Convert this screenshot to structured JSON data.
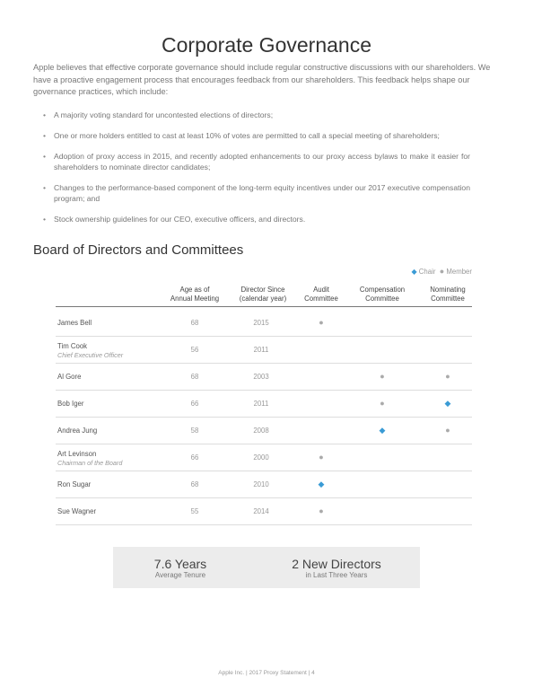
{
  "page": {
    "title": "Corporate Governance",
    "intro": "Apple believes that effective corporate governance should include regular constructive discussions with our shareholders. We have a proactive engagement process that encourages feedback from our shareholders. This feedback helps shape our governance practices, which include:",
    "bullets": [
      "A majority voting standard for uncontested elections of directors;",
      "One or more holders entitled to cast at least 10% of votes are permitted to call a special meeting of shareholders;",
      "Adoption of proxy access in 2015, and recently adopted enhancements to our proxy access bylaws to make it easier for shareholders to nominate director candidates;",
      "Changes to the performance-based component of the long-term equity incentives under our 2017 executive compensation program; and",
      "Stock ownership guidelines for our CEO, executive officers, and directors."
    ]
  },
  "board": {
    "heading": "Board of Directors and Committees",
    "legend": {
      "chair": "Chair",
      "member": "Member"
    },
    "columns": {
      "age_line1": "Age as of",
      "age_line2": "Annual Meeting",
      "since_line1": "Director Since",
      "since_line2": "(calendar year)",
      "audit_line1": "Audit",
      "audit_line2": "Committee",
      "comp_line1": "Compensation",
      "comp_line2": "Committee",
      "nom_line1": "Nominating",
      "nom_line2": "Committee"
    },
    "rows": [
      {
        "name": "James Bell",
        "role": "",
        "age": "68",
        "since": "2015",
        "audit": "member",
        "comp": "",
        "nom": ""
      },
      {
        "name": "Tim Cook",
        "role": "Chief Executive Officer",
        "age": "56",
        "since": "2011",
        "audit": "",
        "comp": "",
        "nom": ""
      },
      {
        "name": "Al Gore",
        "role": "",
        "age": "68",
        "since": "2003",
        "audit": "",
        "comp": "member",
        "nom": "member"
      },
      {
        "name": "Bob Iger",
        "role": "",
        "age": "66",
        "since": "2011",
        "audit": "",
        "comp": "member",
        "nom": "chair"
      },
      {
        "name": "Andrea Jung",
        "role": "",
        "age": "58",
        "since": "2008",
        "audit": "",
        "comp": "chair",
        "nom": "member"
      },
      {
        "name": "Art Levinson",
        "role": "Chairman of the Board",
        "age": "66",
        "since": "2000",
        "audit": "member",
        "comp": "",
        "nom": ""
      },
      {
        "name": "Ron Sugar",
        "role": "",
        "age": "68",
        "since": "2010",
        "audit": "chair",
        "comp": "",
        "nom": ""
      },
      {
        "name": "Sue Wagner",
        "role": "",
        "age": "55",
        "since": "2014",
        "audit": "member",
        "comp": "",
        "nom": ""
      }
    ]
  },
  "stats": {
    "tenure_value": "7.6 Years",
    "tenure_label": "Average Tenure",
    "new_value": "2 New Directors",
    "new_label": "in Last Three Years"
  },
  "footer": "Apple Inc. | 2017 Proxy Statement | 4",
  "colors": {
    "chair": "#3a9bd5",
    "member": "#aaaaaa"
  }
}
